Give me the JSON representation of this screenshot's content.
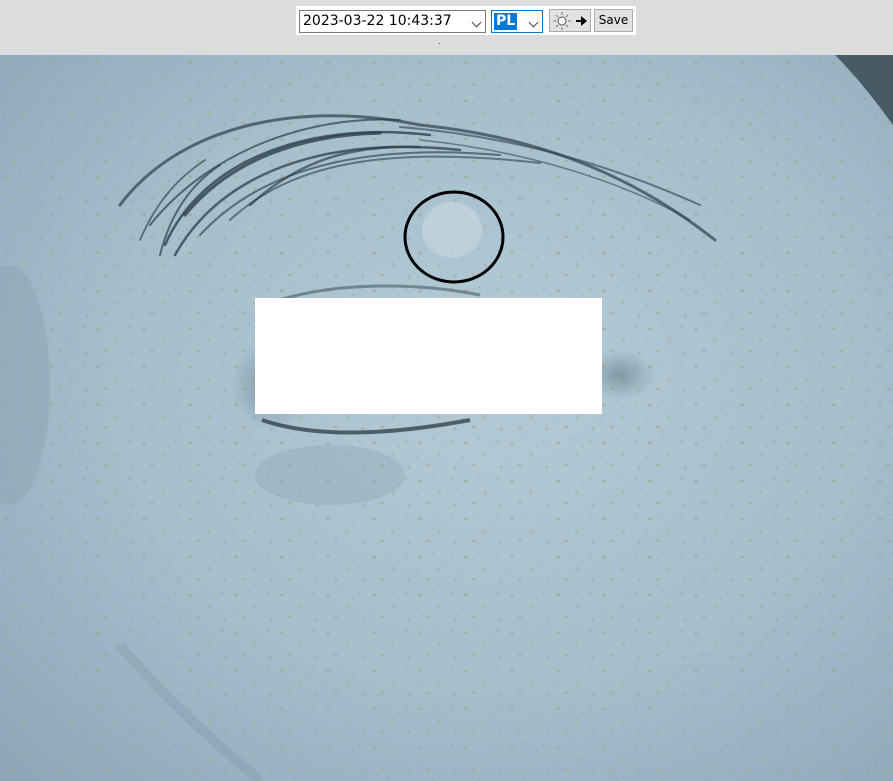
{
  "toolbar": {
    "date_value": "2023-03-22 10:43:37",
    "mode_value": "PL",
    "light_icon": "light-arrow-icon",
    "save_label": "Save"
  },
  "photo": {
    "subject": "skin-closeup-eye-area",
    "annotation_shape": "circle",
    "annotation_color": "#000000",
    "redaction_color": "#ffffff"
  }
}
